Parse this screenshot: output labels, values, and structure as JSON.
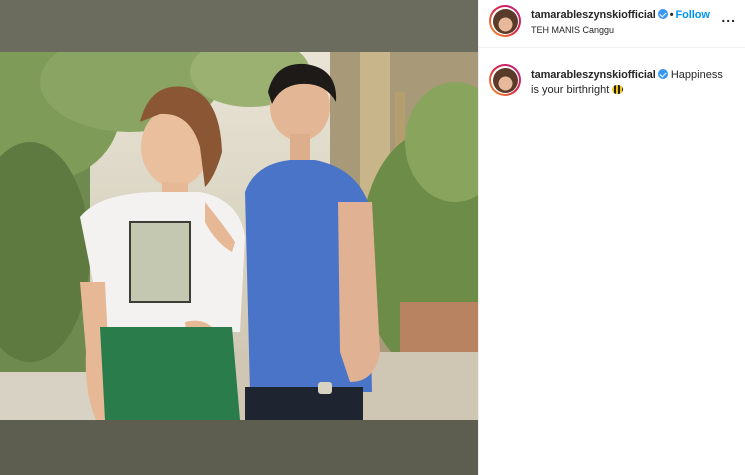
{
  "post": {
    "username": "tamarableszynskiofficial",
    "separator": "•",
    "follow_label": "Follow",
    "location": "TEH MANIS Canggu",
    "more_label": "...",
    "caption_username": "tamarableszynskiofficial",
    "caption_text": "Happiness is your birthright",
    "caption_emoji": "bee-icon"
  },
  "colors": {
    "link_blue": "#0095f6",
    "verified_blue": "#3897f0",
    "text": "#262626",
    "media_frame": "#5e5e50"
  }
}
